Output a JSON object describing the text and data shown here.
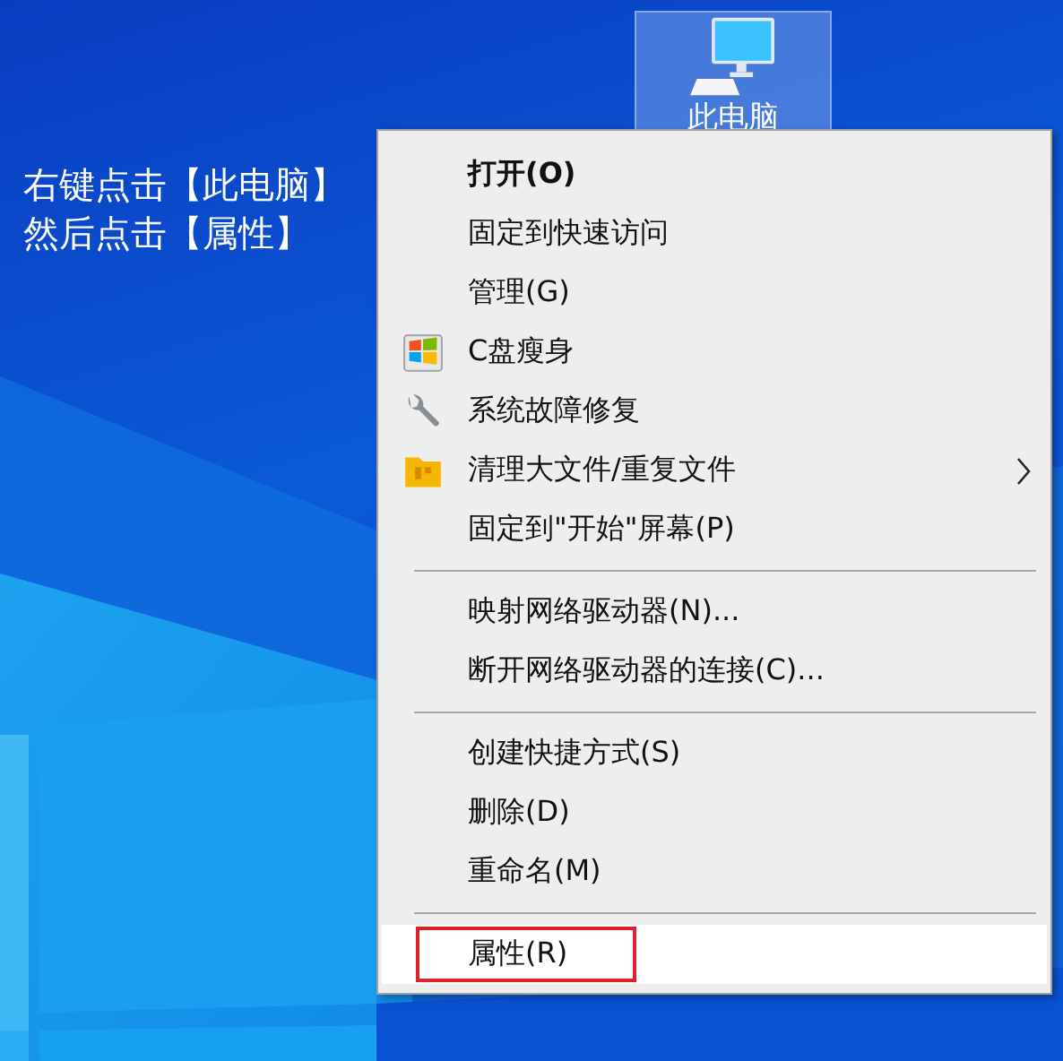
{
  "desktop_icon": {
    "label": "此电脑",
    "selected": true
  },
  "instructions": [
    "右键点击【此电脑】",
    "然后点击【属性】"
  ],
  "context_menu": {
    "groups": [
      {
        "items": [
          {
            "label": "打开(O)",
            "kind": "text",
            "bold": true,
            "submenu": false,
            "selected": false,
            "highlighted": false
          },
          {
            "label": "固定到快速访问",
            "kind": "text",
            "bold": false,
            "submenu": false,
            "selected": false,
            "highlighted": false
          },
          {
            "label": "管理(G)",
            "kind": "text",
            "bold": false,
            "submenu": false,
            "selected": false,
            "highlighted": false
          },
          {
            "label": "C盘瘦身",
            "kind": "drive",
            "bold": false,
            "submenu": false,
            "selected": false,
            "highlighted": false
          },
          {
            "label": "系统故障修复",
            "kind": "tool",
            "bold": false,
            "submenu": false,
            "selected": false,
            "highlighted": false
          },
          {
            "label": "清理大文件/重复文件",
            "kind": "folder",
            "bold": false,
            "submenu": true,
            "selected": false,
            "highlighted": false
          },
          {
            "label": "固定到\"开始\"屏幕(P)",
            "kind": "text",
            "bold": false,
            "submenu": false,
            "selected": false,
            "highlighted": false
          }
        ]
      },
      {
        "items": [
          {
            "label": "映射网络驱动器(N)...",
            "kind": "text",
            "bold": false,
            "submenu": false,
            "selected": false,
            "highlighted": false
          },
          {
            "label": "断开网络驱动器的连接(C)...",
            "kind": "text",
            "bold": false,
            "submenu": false,
            "selected": false,
            "highlighted": false
          }
        ]
      },
      {
        "items": [
          {
            "label": "创建快捷方式(S)",
            "kind": "text",
            "bold": false,
            "submenu": false,
            "selected": false,
            "highlighted": false
          },
          {
            "label": "删除(D)",
            "kind": "text",
            "bold": false,
            "submenu": false,
            "selected": false,
            "highlighted": false
          },
          {
            "label": "重命名(M)",
            "kind": "text",
            "bold": false,
            "submenu": false,
            "selected": false,
            "highlighted": false
          }
        ]
      },
      {
        "items": [
          {
            "label": "属性(R)",
            "kind": "text",
            "bold": false,
            "submenu": false,
            "selected": true,
            "highlighted": true
          }
        ]
      }
    ]
  }
}
